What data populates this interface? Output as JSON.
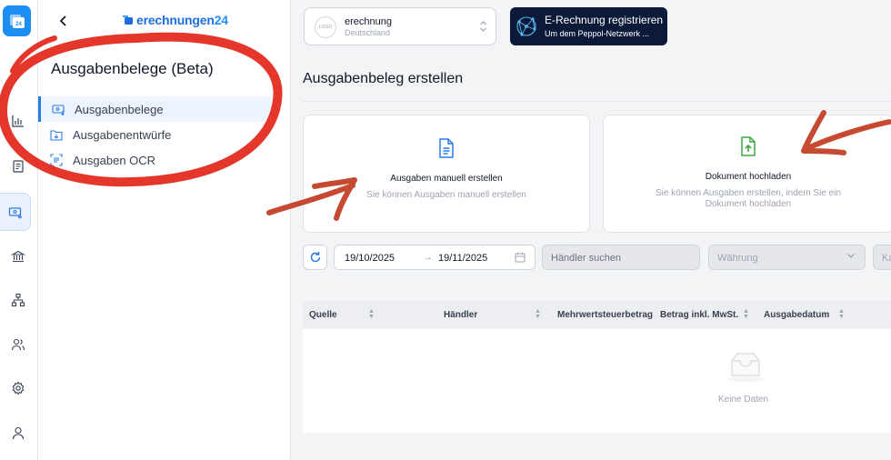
{
  "brand": {
    "name_prefix": "erechnungen",
    "name_suffix": "24",
    "logo_badge": "24"
  },
  "subnav": {
    "title": "Ausgabenbelege (Beta)",
    "items": [
      {
        "label": "Ausgabenbelege",
        "icon": "receipt-icon",
        "active": true
      },
      {
        "label": "Ausgabenentwürfe",
        "icon": "draft-download-icon",
        "active": false
      },
      {
        "label": "Ausgaben OCR",
        "icon": "ocr-scan-icon",
        "active": false
      }
    ]
  },
  "rail": {
    "items": [
      "chart-icon",
      "document-icon",
      "expenses-icon",
      "bank-icon",
      "org-chart-icon",
      "users-icon",
      "settings-icon",
      "profile-icon"
    ],
    "active": "expenses-icon"
  },
  "company": {
    "name": "erechnung",
    "country": "Deutschland",
    "logo_text": "LOGO"
  },
  "peppol": {
    "title": "E-Rechnung registrieren",
    "subtitle": "Um dem Peppol-Netzwerk ..."
  },
  "page": {
    "title": "Ausgabenbeleg erstellen"
  },
  "cards": {
    "manual": {
      "title": "Ausgaben manuell erstellen",
      "description": "Sie können Ausgaben manuell erstellen"
    },
    "upload": {
      "title": "Dokument hochladen",
      "description": "Sie können Ausgaben erstellen, indem Sie ein Dokument hochladen"
    }
  },
  "filters": {
    "date_from": "19/10/2025",
    "date_to": "19/11/2025",
    "date_separator": "→",
    "merchant_placeholder": "Händler suchen",
    "currency_placeholder": "Währung",
    "extra_placeholder": "Ka"
  },
  "table": {
    "columns": [
      "Quelle",
      "Händler",
      "Mehrwertsteuerbetrag",
      "Betrag inkl. MwSt.",
      "Ausgabedatum"
    ],
    "empty_text": "Keine Daten"
  },
  "colors": {
    "accent": "#2b7be5",
    "annotation": "#e4362b",
    "upload_green": "#3aa845",
    "peppol_bg": "#0b1a38"
  }
}
